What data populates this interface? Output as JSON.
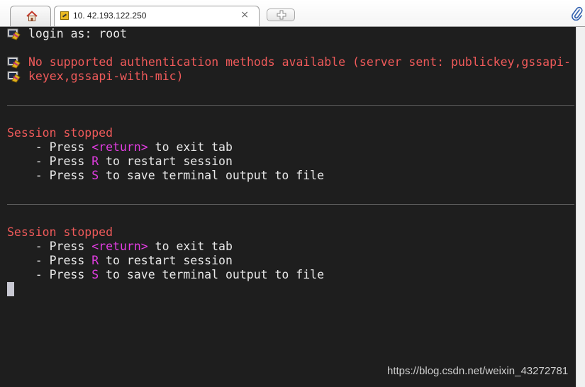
{
  "tabs": {
    "active_title": "10. 42.193.122.250",
    "close_glyph": "×"
  },
  "icons": {
    "home": "home-icon",
    "tab_favicon": "terminal-session-icon",
    "new_tab": "new-tab-plus-icon",
    "attachment": "paperclip-icon",
    "prompt_marker": "putty-terminal-icon"
  },
  "colors": {
    "terminal_bg": "#1e1e1e",
    "text": "#e8e8e8",
    "error": "#f05a5a",
    "key_highlight": "#e23de2"
  },
  "terminal": {
    "login_line": "login as: root",
    "error_line_1": "No supported authentication methods available (server sent: publickey,gssapi-",
    "error_line_2": "keyex,gssapi-with-mic)",
    "sessions": [
      {
        "title": "Session stopped",
        "opt1_prefix": "    - Press ",
        "opt1_key": "<return>",
        "opt1_suffix": " to exit tab",
        "opt2_prefix": "    - Press ",
        "opt2_key": "R",
        "opt2_suffix": " to restart session",
        "opt3_prefix": "    - Press ",
        "opt3_key": "S",
        "opt3_suffix": " to save terminal output to file"
      },
      {
        "title": "Session stopped",
        "opt1_prefix": "    - Press ",
        "opt1_key": "<return>",
        "opt1_suffix": " to exit tab",
        "opt2_prefix": "    - Press ",
        "opt2_key": "R",
        "opt2_suffix": " to restart session",
        "opt3_prefix": "    - Press ",
        "opt3_key": "S",
        "opt3_suffix": " to save terminal output to file"
      }
    ]
  },
  "watermark": "https://blog.csdn.net/weixin_43272781"
}
